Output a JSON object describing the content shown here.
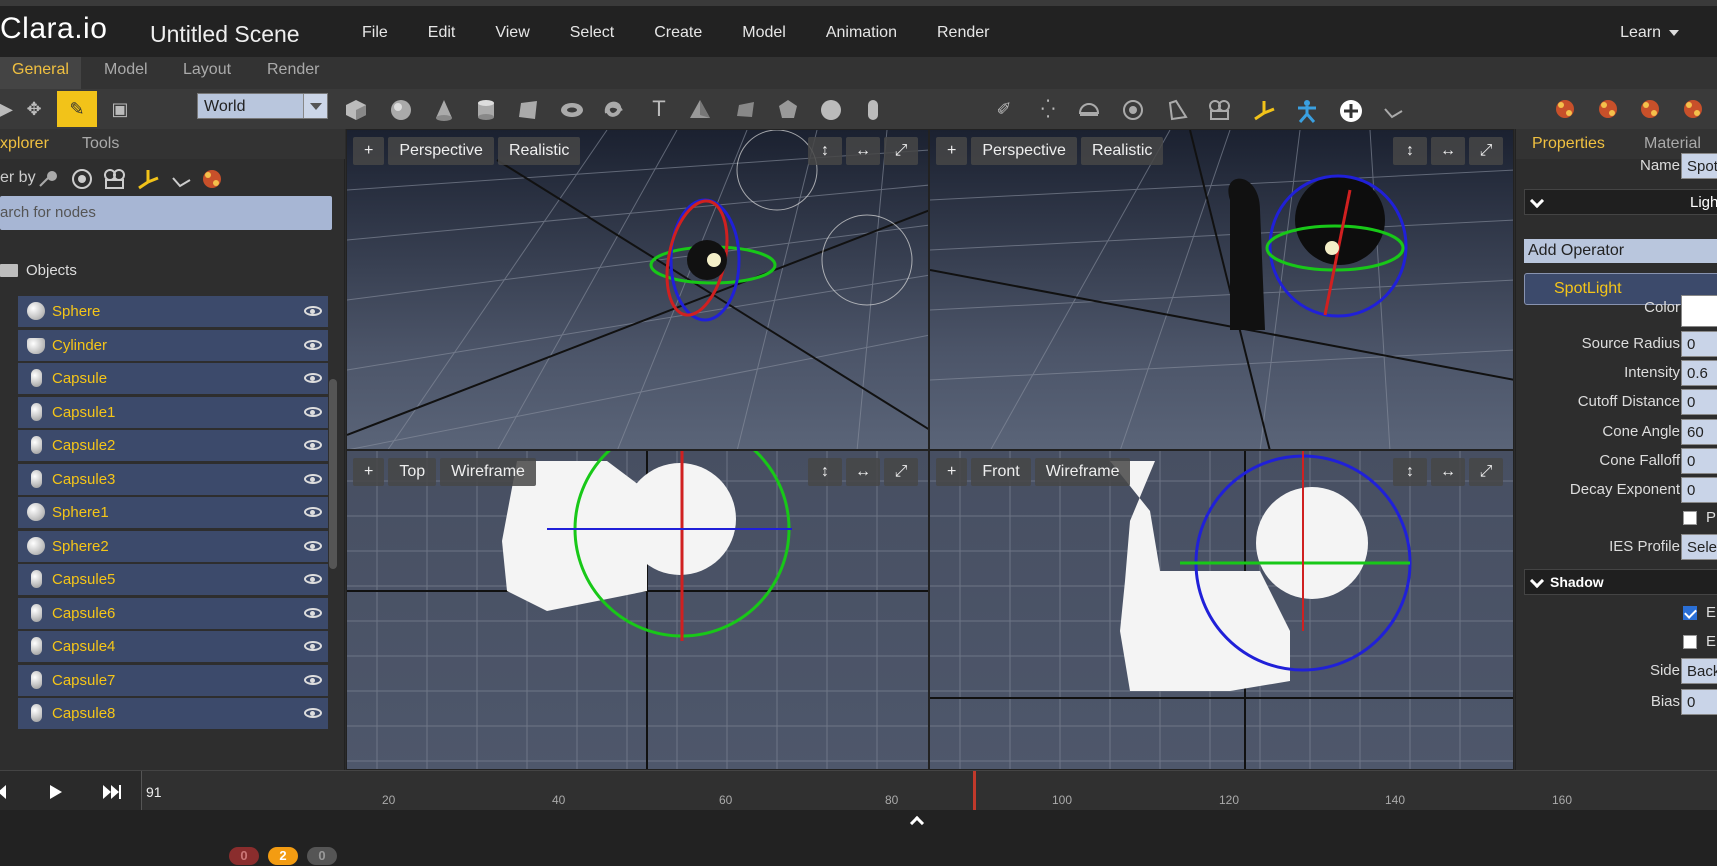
{
  "app": {
    "logo": "Clara.io",
    "scene_title": "Untitled Scene"
  },
  "menu": [
    "File",
    "Edit",
    "View",
    "Select",
    "Create",
    "Model",
    "Animation",
    "Render"
  ],
  "learn": "Learn",
  "mode_tabs": [
    "General",
    "Model",
    "Layout",
    "Render"
  ],
  "toolbar": {
    "coord_space": "World"
  },
  "left_panel": {
    "tabs": [
      "xplorer",
      "Tools"
    ],
    "filter_label": "er by",
    "search_placeholder": "arch for nodes",
    "objects_label": "Objects",
    "items": [
      {
        "name": "Sphere",
        "icon": "sphere-icon"
      },
      {
        "name": "Cylinder",
        "icon": "cylinder-icon"
      },
      {
        "name": "Capsule",
        "icon": "capsule-icon"
      },
      {
        "name": "Capsule1",
        "icon": "capsule-icon"
      },
      {
        "name": "Capsule2",
        "icon": "capsule-icon"
      },
      {
        "name": "Capsule3",
        "icon": "capsule-icon"
      },
      {
        "name": "Sphere1",
        "icon": "sphere-icon"
      },
      {
        "name": "Sphere2",
        "icon": "sphere-icon"
      },
      {
        "name": "Capsule5",
        "icon": "capsule-icon"
      },
      {
        "name": "Capsule6",
        "icon": "capsule-icon"
      },
      {
        "name": "Capsule4",
        "icon": "capsule-icon"
      },
      {
        "name": "Capsule7",
        "icon": "capsule-icon"
      },
      {
        "name": "Capsule8",
        "icon": "capsule-icon"
      }
    ]
  },
  "viewports": {
    "top_left": {
      "plus": "+",
      "camera": "Perspective",
      "shading": "Realistic"
    },
    "top_right": {
      "plus": "+",
      "camera": "Perspective",
      "shading": "Realistic"
    },
    "bottom_left": {
      "plus": "+",
      "camera": "Top",
      "shading": "Wireframe"
    },
    "bottom_right": {
      "plus": "+",
      "camera": "Front",
      "shading": "Wireframe"
    }
  },
  "right_panel": {
    "tabs": [
      "Properties",
      "Material"
    ],
    "name_label": "Name",
    "name_value": "Spot",
    "light_section": "Ligh",
    "add_operator": "Add Operator",
    "operator_item": "SpotLight",
    "props": [
      {
        "label": "Color",
        "value": ""
      },
      {
        "label": "Source Radius",
        "value": "0"
      },
      {
        "label": "Intensity",
        "value": "0.6"
      },
      {
        "label": "Cutoff Distance",
        "value": "0"
      },
      {
        "label": "Cone Angle",
        "value": "60"
      },
      {
        "label": "Cone Falloff",
        "value": "0"
      },
      {
        "label": "Decay Exponent",
        "value": "0"
      }
    ],
    "p_check_label": "P",
    "ies_label": "IES Profile",
    "ies_value": "Selec",
    "shadow_section": "Shadow",
    "shadow_checks": [
      {
        "label": "E",
        "checked": true
      },
      {
        "label": "E",
        "checked": false
      }
    ],
    "side_label": "Side",
    "side_value": "Back",
    "bias_label": "Bias",
    "bias_value": "0"
  },
  "timeline": {
    "current_frame": "91",
    "ticks": [
      "20",
      "40",
      "60",
      "80",
      "100",
      "120",
      "140",
      "160"
    ]
  },
  "status_badges": [
    {
      "value": "0",
      "color": "#8a2d2d"
    },
    {
      "value": "2",
      "color": "#f39c12"
    },
    {
      "value": "0",
      "color": "#555555"
    }
  ],
  "colors": {
    "accent": "#f5c518",
    "list_bg": "#3c4a6b",
    "active_tool": "#f2c319"
  }
}
